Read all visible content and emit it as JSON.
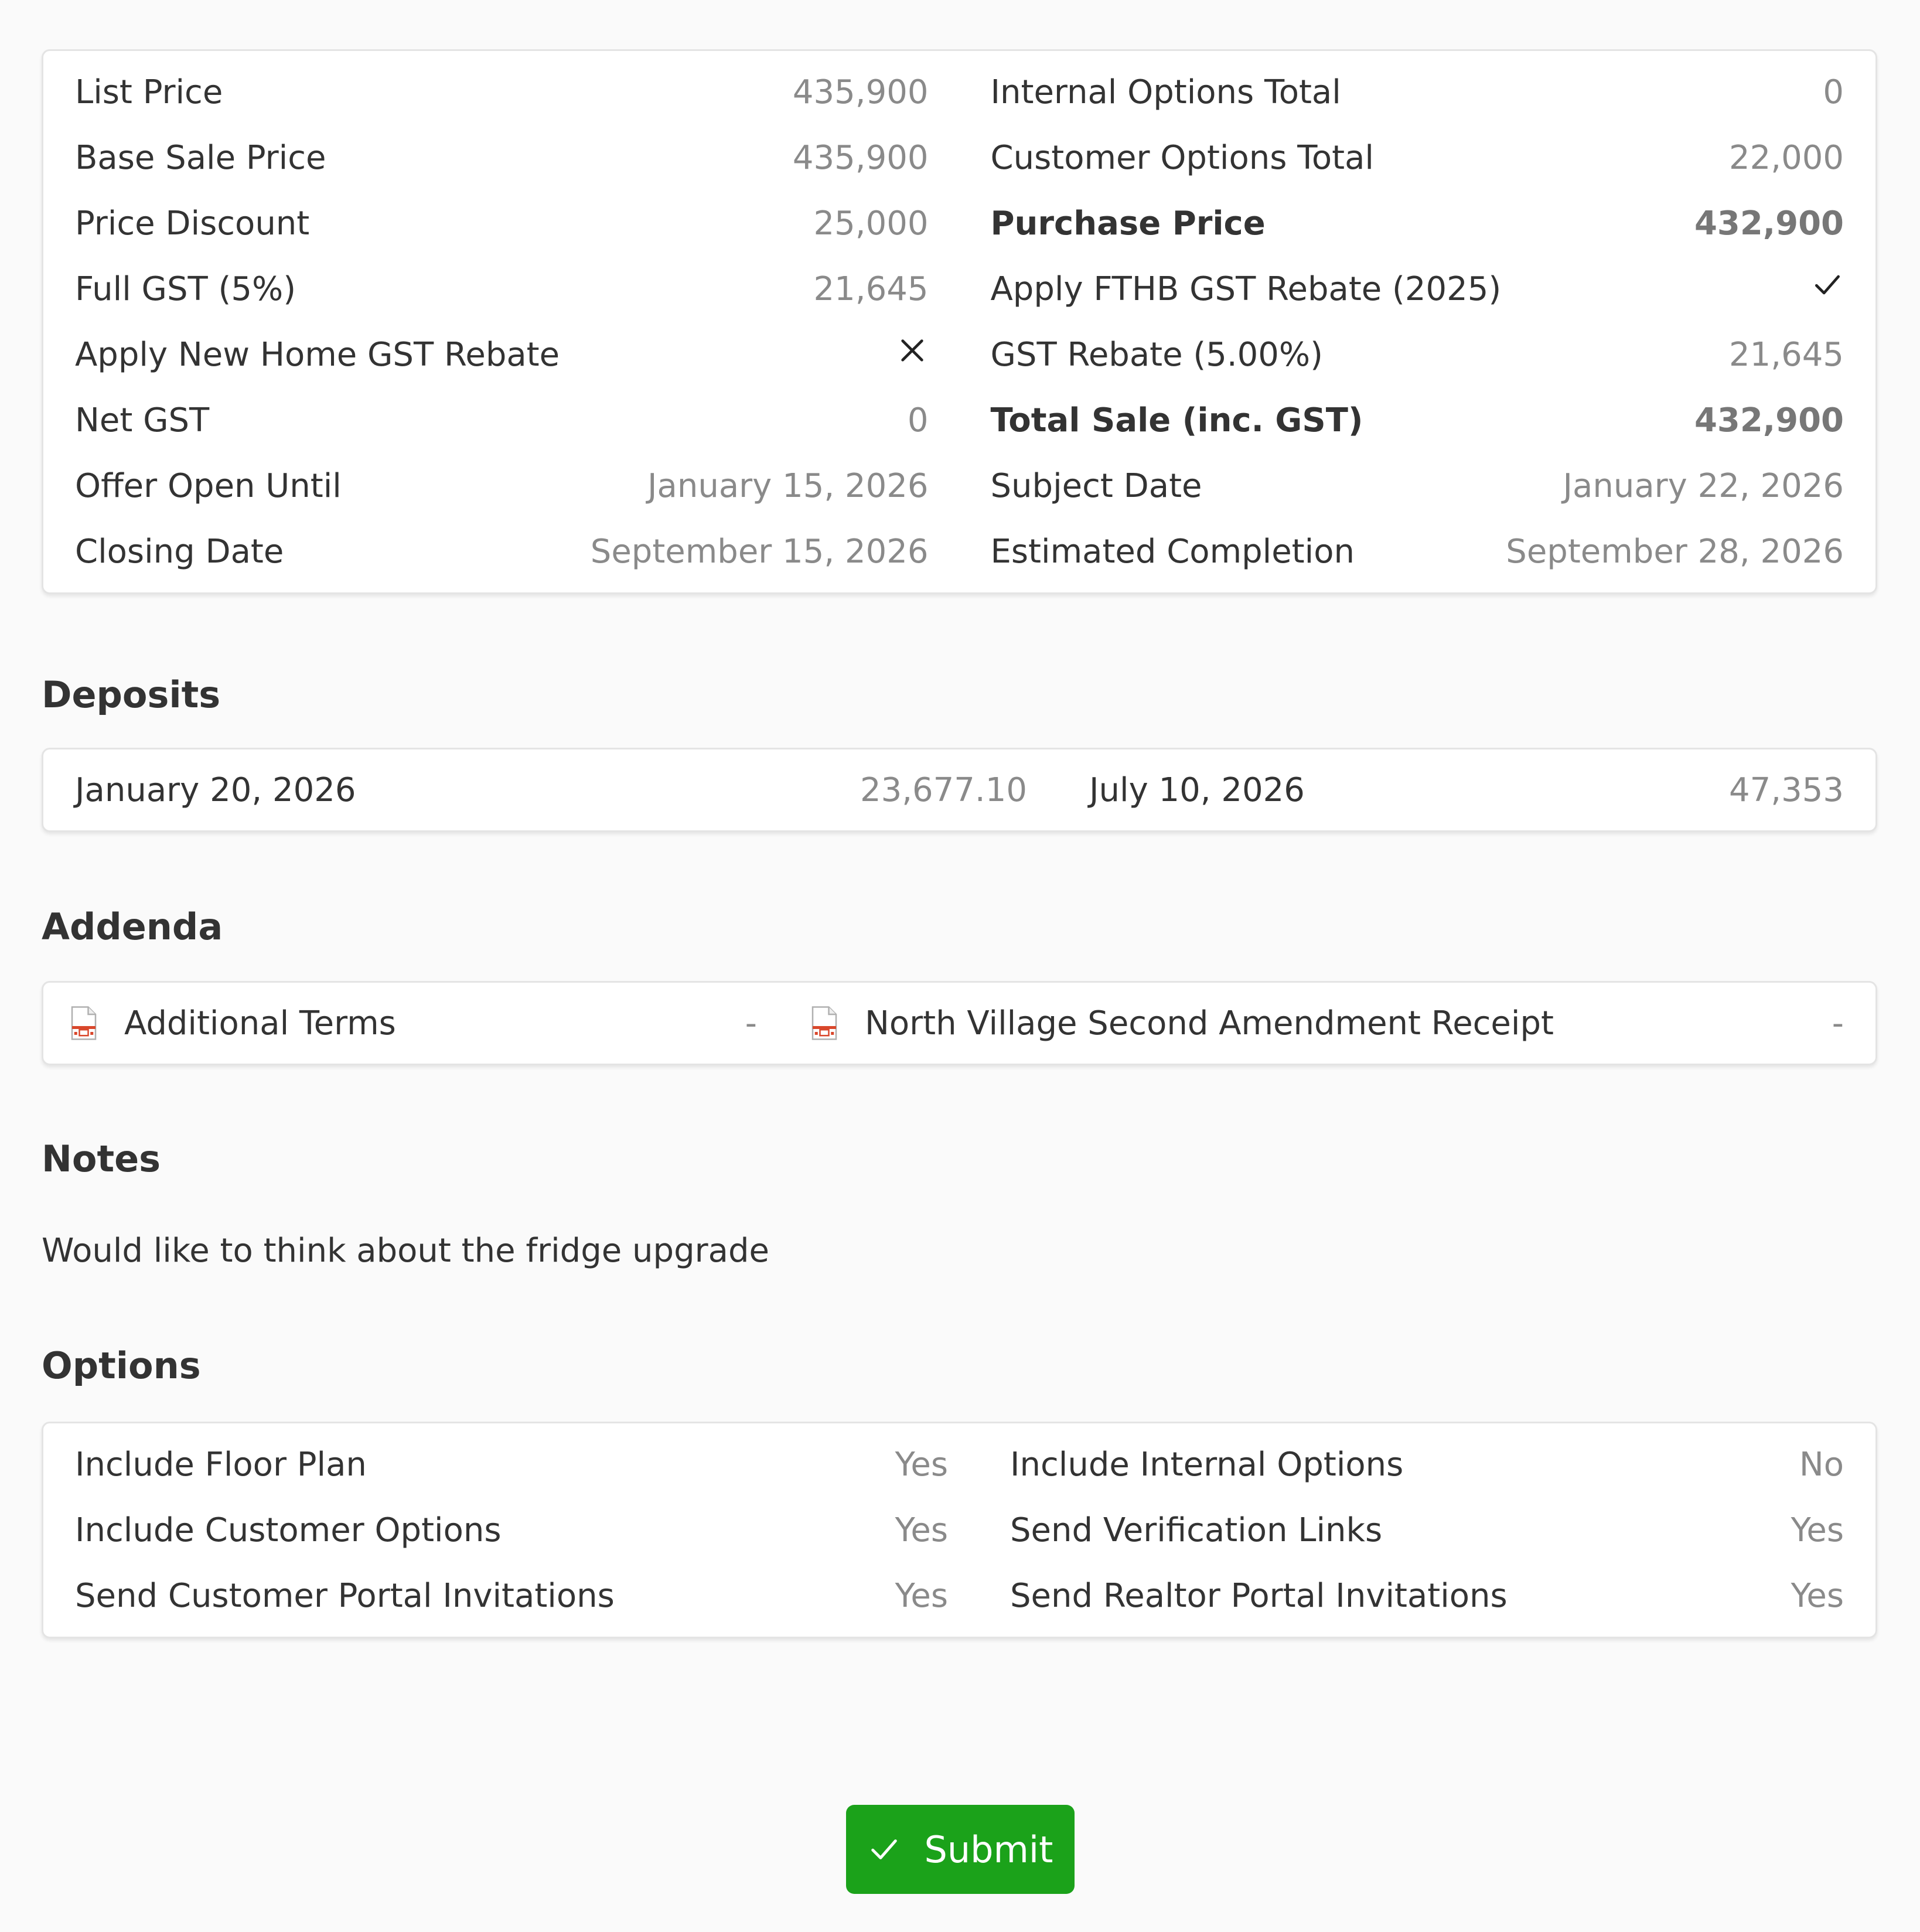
{
  "summary": {
    "left": [
      {
        "label": "List Price",
        "value": "435,900"
      },
      {
        "label": "Base Sale Price",
        "value": "435,900"
      },
      {
        "label": "Price Discount",
        "value": "25,000"
      },
      {
        "label": "Full GST (5%)",
        "value": "21,645"
      },
      {
        "label": "Apply New Home GST Rebate",
        "icon": "x-icon"
      },
      {
        "label": "Net GST",
        "value": "0"
      },
      {
        "label": "Offer Open Until",
        "value": "January 15, 2026"
      },
      {
        "label": "Closing Date",
        "value": "September 15, 2026"
      }
    ],
    "right": [
      {
        "label": "Internal Options Total",
        "value": "0"
      },
      {
        "label": "Customer Options Total",
        "value": "22,000"
      },
      {
        "label": "Purchase Price",
        "value": "432,900"
      },
      {
        "label": "Apply FTHB GST Rebate (2025)",
        "icon": "checkmark-icon"
      },
      {
        "label": "GST Rebate (5.00%)",
        "value": "21,645"
      },
      {
        "label": "Total Sale (inc. GST)",
        "value": "432,900"
      },
      {
        "label": "Subject Date",
        "value": "January 22, 2026"
      },
      {
        "label": "Estimated Completion",
        "value": "September 28, 2026"
      }
    ]
  },
  "deposits": {
    "title": "Deposits",
    "items": [
      {
        "date": "January 20, 2026",
        "amount": "23,677.10"
      },
      {
        "date": "July 10, 2026",
        "amount": "47,353"
      }
    ]
  },
  "addenda": {
    "title": "Addenda",
    "items": [
      {
        "name": "Additional Terms",
        "value": "-",
        "icon": "pdf-file-icon"
      },
      {
        "name": "North Village Second Amendment Receipt",
        "value": "-",
        "icon": "pdf-file-icon"
      }
    ]
  },
  "notes": {
    "title": "Notes",
    "text": "Would like to think about the fridge upgrade"
  },
  "options": {
    "title": "Options",
    "left": [
      {
        "label": "Include Floor Plan",
        "value": "Yes"
      },
      {
        "label": "Include Customer Options",
        "value": "Yes"
      },
      {
        "label": "Send Customer Portal Invitations",
        "value": "Yes"
      }
    ],
    "right": [
      {
        "label": "Include Internal Options",
        "value": "No"
      },
      {
        "label": "Send Verification Links",
        "value": "Yes"
      },
      {
        "label": "Send Realtor Portal Invitations",
        "value": "Yes"
      }
    ]
  },
  "submit": {
    "label": "Submit",
    "icon": "checkmark-icon"
  },
  "colors": {
    "submit_background": "#1ba21a",
    "page_background": "#fafafa",
    "label_text": "#333333",
    "value_text": "#8a8a8a",
    "pdf_icon": "#d9472b"
  }
}
